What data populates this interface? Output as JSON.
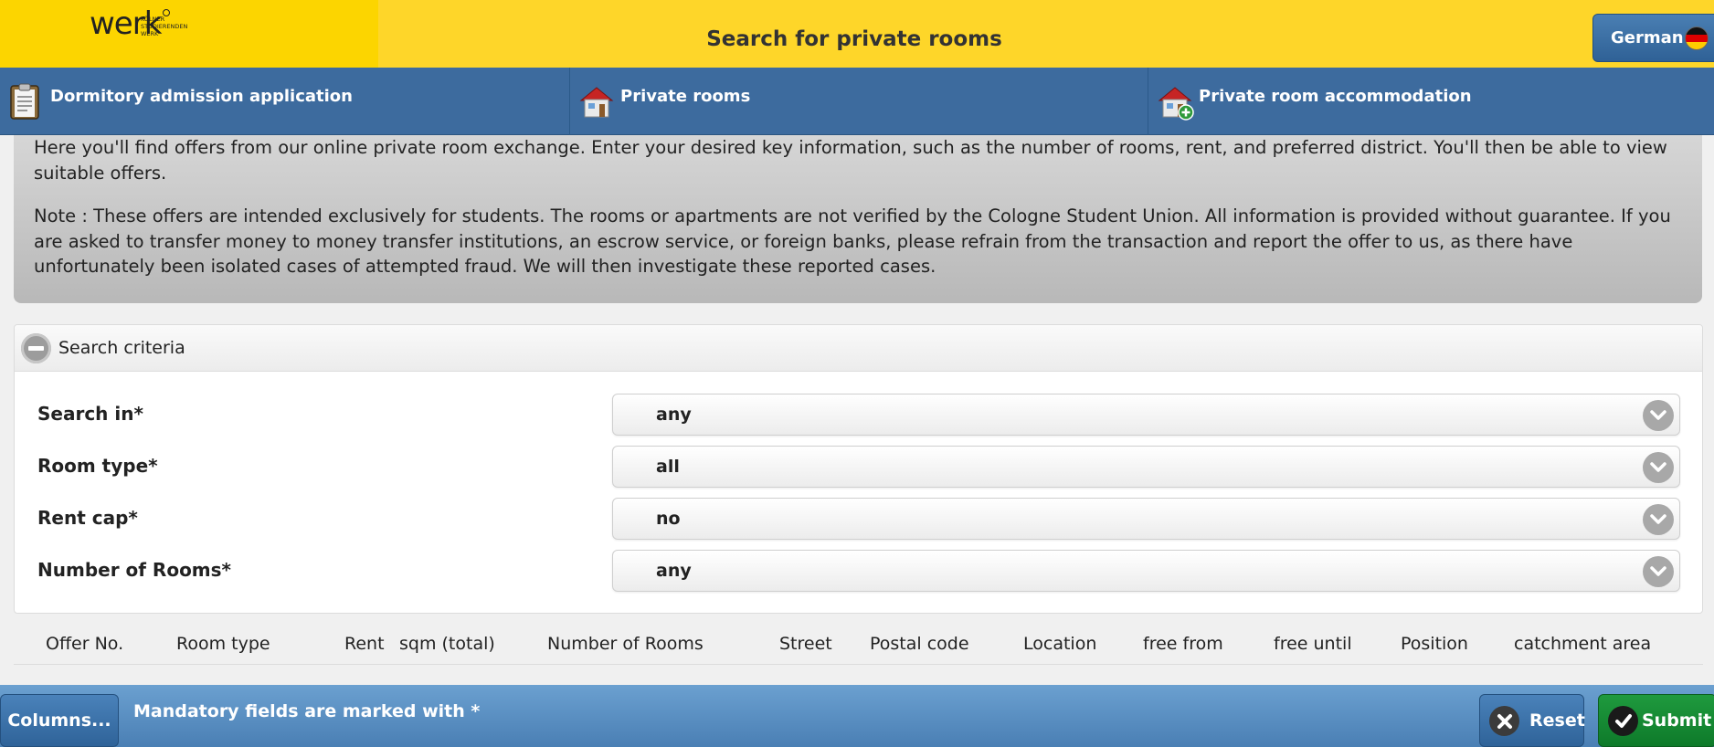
{
  "header": {
    "logo_word": "werk",
    "logo_small_lines": [
      "KÖLNER",
      "STUDIERENDEN",
      "WERK"
    ],
    "title": "Search for private rooms",
    "language_label": "German",
    "language_icon": "german-flag-icon"
  },
  "nav": {
    "items": [
      {
        "label": "Dormitory admission application",
        "icon": "clipboard-icon"
      },
      {
        "label": "Private rooms",
        "icon": "house-icon"
      },
      {
        "label": "Private room accommodation",
        "icon": "house-add-icon"
      }
    ]
  },
  "info": {
    "paragraph1": "Here you'll find offers from our online private room exchange. Enter your desired key information, such as the number of rooms, rent, and preferred district. You'll then be able to view suitable offers.",
    "paragraph2": "Note : These offers are intended exclusively for students. The rooms or apartments are not verified by the Cologne Student Union. All information is provided without guarantee. If you are asked to transfer money to money transfer institutions, an escrow service, or foreign banks, please refrain from the transaction and report the offer to us, as there have unfortunately been isolated cases of attempted fraud. We will then investigate these reported cases."
  },
  "criteria": {
    "title": "Search criteria",
    "fields": [
      {
        "label": "Search in*",
        "value": "any"
      },
      {
        "label": "Room type*",
        "value": "all"
      },
      {
        "label": "Rent cap*",
        "value": "no"
      },
      {
        "label": "Number of Rooms*",
        "value": "any"
      }
    ]
  },
  "table": {
    "columns": [
      "Offer No.",
      "Room type",
      "Rent",
      "sqm (total)",
      "Number of Rooms",
      "Street",
      "Postal code",
      "Location",
      "free from",
      "free until",
      "Position",
      "catchment area"
    ]
  },
  "footer": {
    "columns_label": "Columns...",
    "note": "Mandatory fields are marked with *",
    "reset_label": "Reset",
    "submit_label": "Submit"
  },
  "colors": {
    "header_yellow": "#fed629",
    "nav_blue": "#3d6b9e",
    "footer_blue": "#5a8fc2",
    "submit_green": "#158a33"
  }
}
